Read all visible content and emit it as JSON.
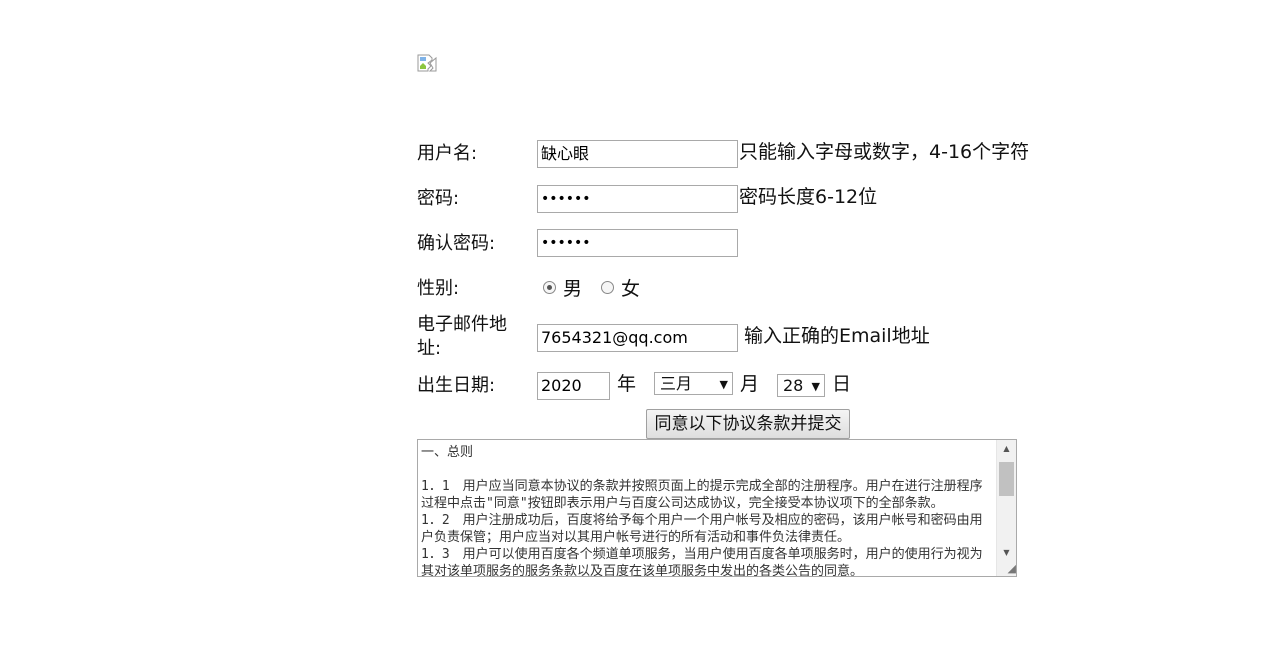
{
  "form": {
    "username": {
      "label": "用户名:",
      "value": "缺心眼",
      "tip": "只能输入字母或数字，4-16个字符"
    },
    "password": {
      "label": "密码:",
      "value": "••••••",
      "tip": "密码长度6-12位"
    },
    "confirm_password": {
      "label": "确认密码:",
      "value": "••••••"
    },
    "gender": {
      "label": "性别:",
      "options": [
        "男",
        "女"
      ],
      "selected": "男"
    },
    "email": {
      "label_line1": "电子邮件地",
      "label_line2": "址:",
      "value": "7654321@qq.com",
      "tip": "输入正确的Email地址"
    },
    "birthday": {
      "label": "出生日期:",
      "year": "2020",
      "year_unit": "年",
      "month": "三月",
      "month_unit": "月",
      "day": "28",
      "day_unit": "日"
    },
    "submit_label": "同意以下协议条款并提交"
  },
  "agreement": {
    "text": "一、总则\n\n1．1　用户应当同意本协议的条款并按照页面上的提示完成全部的注册程序。用户在进行注册程序过程中点击\"同意\"按钮即表示用户与百度公司达成协议，完全接受本协议项下的全部条款。\n1．2　用户注册成功后，百度将给予每个用户一个用户帐号及相应的密码，该用户帐号和密码由用户负责保管；用户应当对以其用户帐号进行的所有活动和事件负法律责任。\n1．3　用户可以使用百度各个频道单项服务，当用户使用百度各单项服务时，用户的使用行为视为其对该单项服务的服务条款以及百度在该单项服务中发出的各类公告的同意。"
  },
  "icons": {
    "broken_image": "broken-image-icon",
    "select_arrow": "▼",
    "scroll_up": "▲",
    "scroll_down": "▼",
    "resize_grip": "◢"
  }
}
